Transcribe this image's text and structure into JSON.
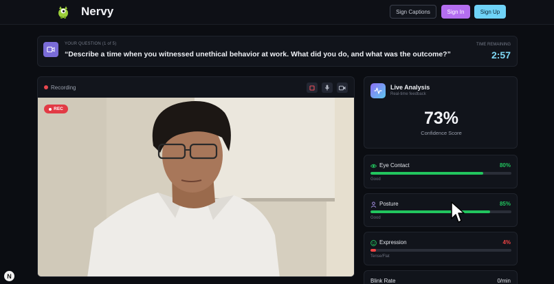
{
  "app": {
    "name": "Nervy"
  },
  "header": {
    "captions_label": "Sign Captions",
    "signin_label": "Sign In",
    "signup_label": "Sign Up"
  },
  "question": {
    "label": "YOUR QUESTION (1 of 5)",
    "text": "“Describe a time when you witnessed unethical behavior at work. What did you do, and what was the outcome?”",
    "time_label": "TIME REMAINING",
    "time_value": "2:57"
  },
  "video": {
    "status_label": "Recording",
    "badge_label": "REC",
    "controls": [
      "stop-icon",
      "mic-icon",
      "camera-icon"
    ]
  },
  "analysis": {
    "title": "Live Analysis",
    "subtitle": "Real-time feedback",
    "score": "73%",
    "score_label": "Confidence Score"
  },
  "metrics": [
    {
      "name": "Eye Contact",
      "value": "80%",
      "level": 0.8,
      "status": "Good",
      "color": "#22c55e",
      "icon": "eye-icon"
    },
    {
      "name": "Posture",
      "value": "85%",
      "level": 0.85,
      "status": "Good",
      "color": "#22c55e",
      "icon": "person-icon"
    },
    {
      "name": "Expression",
      "value": "4%",
      "level": 0.04,
      "status": "Tense/Flat",
      "color": "#ef4444",
      "icon": "smile-icon"
    }
  ],
  "blink": {
    "name": "Blink Rate",
    "value": "0/min"
  },
  "corner_badge": "N",
  "colors": {
    "accent_purple": "#b46ef0",
    "accent_cyan": "#6fd3f7",
    "good": "#22c55e",
    "bad": "#ef4444",
    "background": "#0b0d12"
  }
}
